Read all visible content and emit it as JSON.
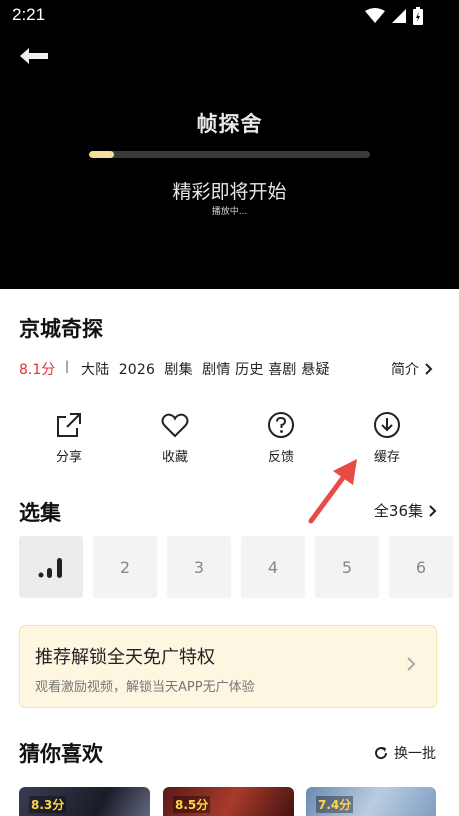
{
  "status_bar": {
    "time": "2:21"
  },
  "player": {
    "title": "帧探舍",
    "progress_fraction": 0.09,
    "message": "精彩即将开始",
    "sub_message": "播放中..."
  },
  "show": {
    "title": "京城奇探",
    "rating": "8.1分",
    "separator": "|",
    "tags": "大陆  2026  剧集  剧情 历史 喜剧 悬疑",
    "intro_label": "简介"
  },
  "actions": [
    {
      "label": "分享",
      "icon": "share-icon"
    },
    {
      "label": "收藏",
      "icon": "heart-icon"
    },
    {
      "label": "反馈",
      "icon": "help-circle-icon"
    },
    {
      "label": "缓存",
      "icon": "download-icon"
    }
  ],
  "episodes": {
    "title": "选集",
    "all_label": "全36集",
    "items": [
      "2",
      "3",
      "4",
      "5",
      "6"
    ]
  },
  "promo": {
    "title": "推荐解锁全天免广特权",
    "subtitle": "观看激励视频，解锁当天APP无广体验"
  },
  "recommend": {
    "title": "猜你喜欢",
    "refresh_label": "换一批",
    "items": [
      {
        "score": "8.3分"
      },
      {
        "score": "8.5分"
      },
      {
        "score": "7.4分"
      }
    ]
  },
  "colors": {
    "accent_red": "#e0323a",
    "progress_fill": "#f5dd9a",
    "promo_bg": "#fdf6e0",
    "annotation_arrow": "#e84a45"
  }
}
